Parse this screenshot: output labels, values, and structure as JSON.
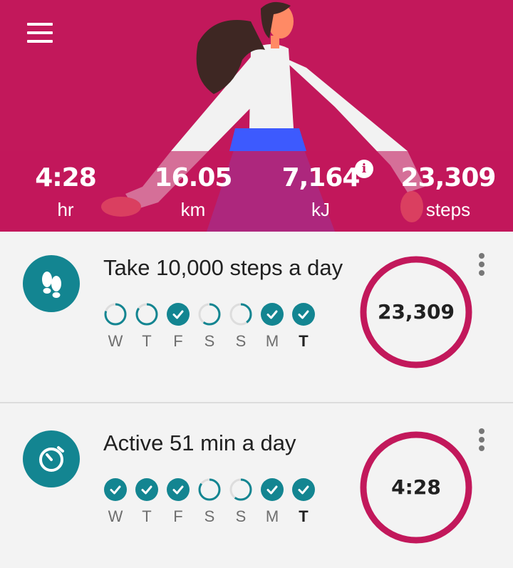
{
  "colors": {
    "brand": "#c2185b",
    "teal": "#138591",
    "ring_bg": "#dddddd"
  },
  "header": {
    "menu_icon": "hamburger-menu-icon",
    "stats": [
      {
        "value": "4:28",
        "unit": "hr"
      },
      {
        "value": "16.05",
        "unit": "km"
      },
      {
        "value": "7,164",
        "unit": "kJ"
      },
      {
        "value": "23,309",
        "unit": "steps"
      }
    ],
    "info_icon": "info-icon",
    "info_glyph": "i"
  },
  "goals": [
    {
      "icon": "footsteps-icon",
      "title": "Take 10,000 steps a day",
      "value": "23,309",
      "days": [
        {
          "label": "W",
          "progress": 0.8,
          "today": false
        },
        {
          "label": "T",
          "progress": 0.85,
          "today": false
        },
        {
          "label": "F",
          "progress": 1,
          "today": false
        },
        {
          "label": "S",
          "progress": 0.6,
          "today": false
        },
        {
          "label": "S",
          "progress": 0.4,
          "today": false
        },
        {
          "label": "M",
          "progress": 1,
          "today": false
        },
        {
          "label": "T",
          "progress": 1,
          "today": true
        }
      ]
    },
    {
      "icon": "timer-icon",
      "title": "Active 51 min a day",
      "value": "4:28",
      "days": [
        {
          "label": "W",
          "progress": 1,
          "today": false
        },
        {
          "label": "T",
          "progress": 1,
          "today": false
        },
        {
          "label": "F",
          "progress": 1,
          "today": false
        },
        {
          "label": "S",
          "progress": 0.85,
          "today": false
        },
        {
          "label": "S",
          "progress": 0.6,
          "today": false
        },
        {
          "label": "M",
          "progress": 1,
          "today": false
        },
        {
          "label": "T",
          "progress": 1,
          "today": true
        }
      ]
    }
  ]
}
